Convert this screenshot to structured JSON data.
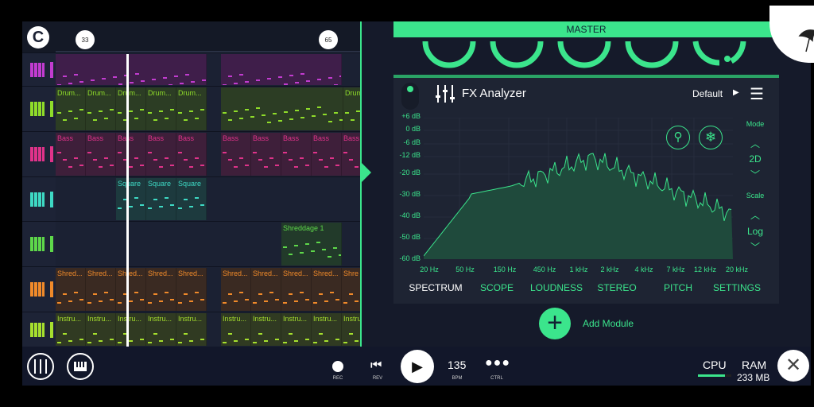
{
  "ruler": {
    "markers": [
      "33",
      "65"
    ]
  },
  "tracks": [
    {
      "name": "piano-purple",
      "color": "#c23cd0",
      "bg": "#3f1e4a",
      "clips": []
    },
    {
      "name": "drums",
      "color": "#8fdc2a",
      "bg": "#2c3d24",
      "clips": [
        "Drum...",
        "Drum...",
        "Drum...",
        "Drum...",
        "Drum...",
        "Drum"
      ]
    },
    {
      "name": "bass",
      "color": "#e0338a",
      "bg": "#3e1f3a",
      "clips": [
        "Bass",
        "Bass",
        "Bass",
        "Bass",
        "Bass",
        "Bass",
        "Bass",
        "Bass",
        "Bass",
        "Bass"
      ]
    },
    {
      "name": "square",
      "color": "#3ed9c4",
      "bg": "#1d3a3e",
      "clips": [
        "Square",
        "Square",
        "Square"
      ]
    },
    {
      "name": "shreddage",
      "color": "#5ed84a",
      "bg": "#223a2a",
      "clips": [
        "Shreddage 1"
      ]
    },
    {
      "name": "shred",
      "color": "#f08a2a",
      "bg": "#3a2a22",
      "clips": [
        "Shred...",
        "Shred...",
        "Shred...",
        "Shred...",
        "Shred...",
        "Shred...",
        "Shred...",
        "Shred...",
        "Shred...",
        "Shre"
      ]
    },
    {
      "name": "instru",
      "color": "#a6e02e",
      "bg": "#303a22",
      "clips": [
        "Instru...",
        "Instru...",
        "Instru...",
        "Instru...",
        "Instru...",
        "Instru...",
        "Instru...",
        "Instru...",
        "Instru...",
        "Instru"
      ]
    }
  ],
  "master": {
    "title": "MASTER"
  },
  "fx": {
    "title": "FX Analyzer",
    "preset": "Default",
    "db_labels": [
      "+6 dB",
      "0 dB",
      "-6 dB",
      "-12 dB",
      "-20 dB",
      "-30 dB",
      "-40 dB",
      "-50 dB",
      "-60 dB"
    ],
    "hz_labels": [
      "20 Hz",
      "50 Hz",
      "150 Hz",
      "450 Hz",
      "1 kHz",
      "2 kHz",
      "4 kHz",
      "7 kHz",
      "12 kHz",
      "20 kHz"
    ],
    "tabs": [
      "SPECTRUM",
      "SCOPE",
      "LOUDNESS",
      "STEREO",
      "PITCH",
      "SETTINGS"
    ],
    "active_tab": "SPECTRUM",
    "mode_label": "Mode",
    "mode_value": "2D",
    "scale_label": "Scale",
    "scale_value": "Log"
  },
  "add_module": "Add Module",
  "transport": {
    "rec": "REC",
    "rev": "REV",
    "bpm": "135",
    "bpm_label": "BPM",
    "ctrl": "CTRL",
    "cpu": "CPU",
    "cpu_level": 0.8,
    "ram": "RAM",
    "ram_value": "233 MB"
  },
  "colors": {
    "accent": "#3be58c",
    "bg": "#151a2a"
  }
}
